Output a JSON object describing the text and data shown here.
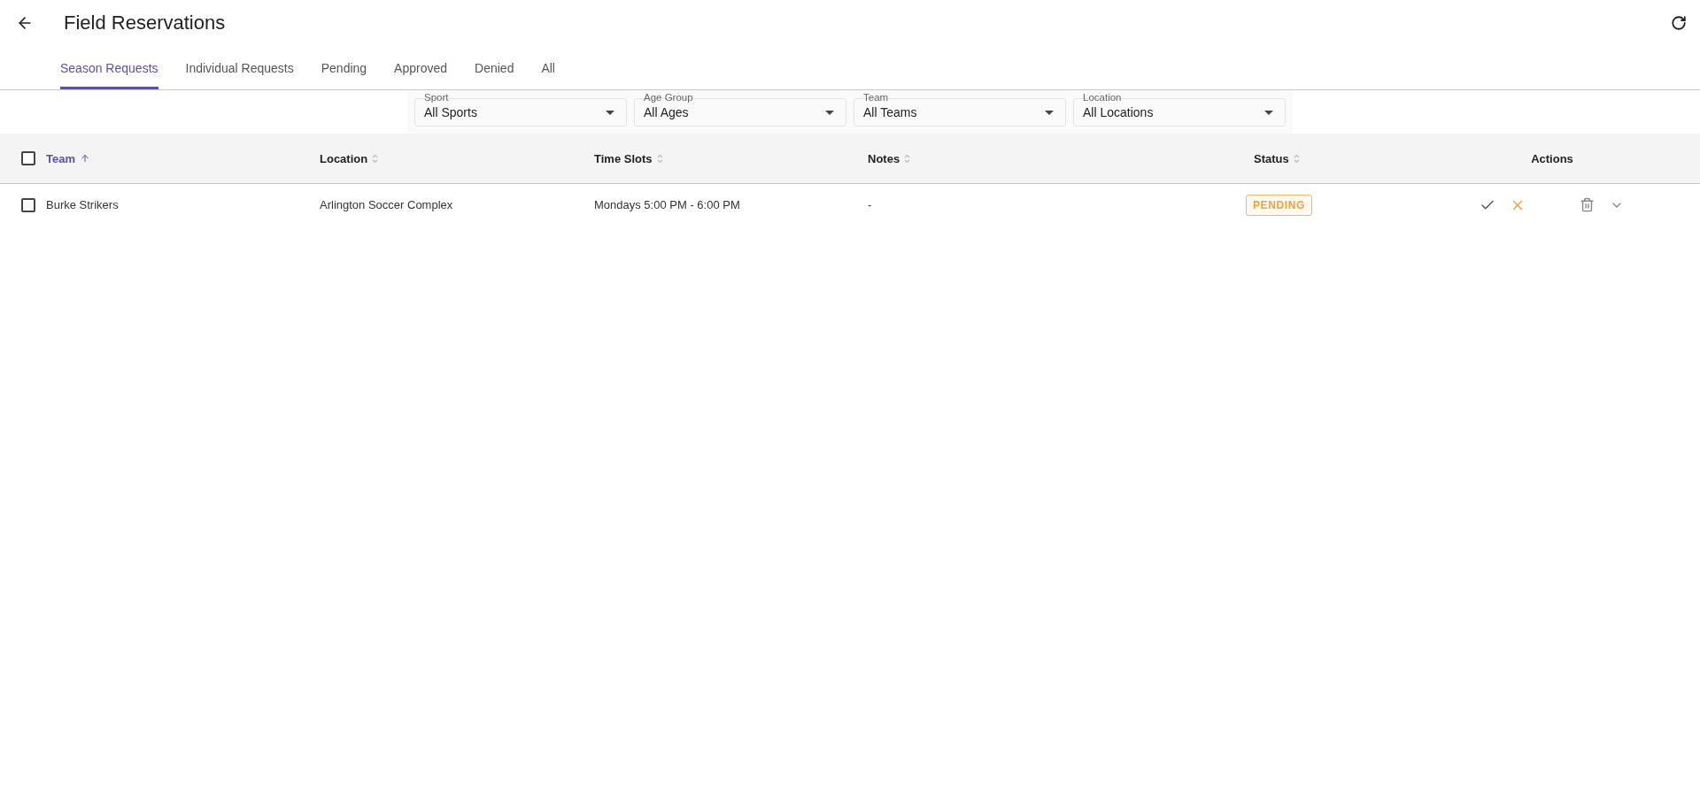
{
  "header": {
    "title": "Field Reservations"
  },
  "tabs": [
    {
      "label": "Season Requests",
      "selected": true
    },
    {
      "label": "Individual Requests",
      "selected": false
    },
    {
      "label": "Pending",
      "selected": false
    },
    {
      "label": "Approved",
      "selected": false
    },
    {
      "label": "Denied",
      "selected": false
    },
    {
      "label": "All",
      "selected": false
    }
  ],
  "filters": [
    {
      "label": "Sport",
      "value": "All Sports"
    },
    {
      "label": "Age Group",
      "value": "All Ages"
    },
    {
      "label": "Team",
      "value": "All Teams"
    },
    {
      "label": "Location",
      "value": "All Locations"
    }
  ],
  "table": {
    "select_all": {
      "checked": false
    },
    "columns": [
      {
        "label": "Team",
        "sortable": true,
        "sorted": true
      },
      {
        "label": "Location",
        "sortable": true,
        "sorted": false
      },
      {
        "label": "Time Slots",
        "sortable": true,
        "sorted": false
      },
      {
        "label": "Notes",
        "sortable": true,
        "sorted": false
      },
      {
        "label": "Status",
        "sortable": true,
        "sorted": false
      },
      {
        "label": "Actions",
        "sortable": false,
        "sorted": false
      }
    ],
    "rows": [
      {
        "checked": false,
        "team": "Burke Strikers",
        "location": "Arlington Soccer Complex",
        "time_slots": "Mondays 5:00 PM - 6:00 PM",
        "notes": "-",
        "status": {
          "label": "PENDING",
          "kind": "pending"
        },
        "expanded": false
      }
    ]
  }
}
